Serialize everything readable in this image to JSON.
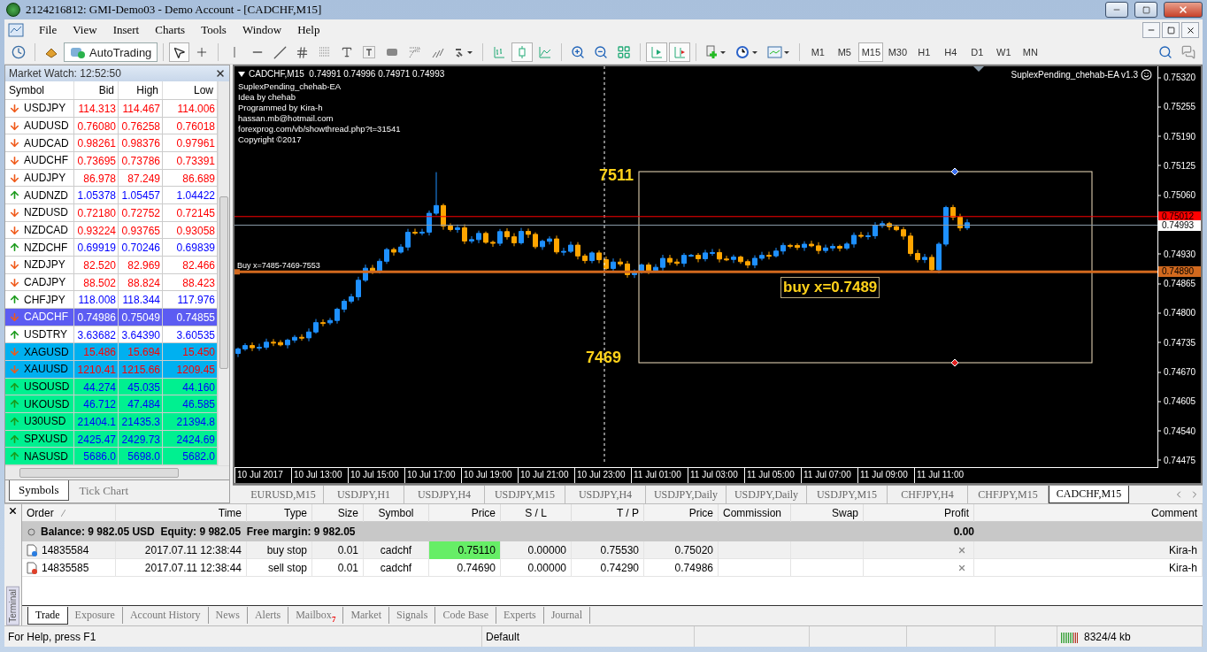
{
  "window": {
    "title": "2124216812: GMI-Demo03 - Demo Account - [CADCHF,M15]"
  },
  "menu": [
    "File",
    "View",
    "Insert",
    "Charts",
    "Tools",
    "Window",
    "Help"
  ],
  "toolbar": {
    "autotrading": {
      "label": "AutoTrading",
      "on": true
    },
    "timeframes": [
      {
        "label": "M1",
        "selected": false
      },
      {
        "label": "M5",
        "selected": false
      },
      {
        "label": "M15",
        "selected": true
      },
      {
        "label": "M30",
        "selected": false
      },
      {
        "label": "H1",
        "selected": false
      },
      {
        "label": "H4",
        "selected": false
      },
      {
        "label": "D1",
        "selected": false
      },
      {
        "label": "W1",
        "selected": false
      },
      {
        "label": "MN",
        "selected": false
      }
    ]
  },
  "market_watch": {
    "title": "Market Watch: 12:52:50",
    "columns": [
      "Symbol",
      "Bid",
      "High",
      "Low"
    ],
    "rows": [
      {
        "symbol": "USDJPY",
        "bid": "114.313",
        "high": "114.467",
        "low": "114.006",
        "kind": "down",
        "color": "#ffffff",
        "selected": false
      },
      {
        "symbol": "AUDUSD",
        "bid": "0.76080",
        "high": "0.76258",
        "low": "0.76018",
        "kind": "down",
        "color": "#ffffff",
        "selected": false
      },
      {
        "symbol": "AUDCAD",
        "bid": "0.98261",
        "high": "0.98376",
        "low": "0.97961",
        "kind": "down",
        "color": "#ffffff",
        "selected": false
      },
      {
        "symbol": "AUDCHF",
        "bid": "0.73695",
        "high": "0.73786",
        "low": "0.73391",
        "kind": "down",
        "color": "#ffffff",
        "selected": false
      },
      {
        "symbol": "AUDJPY",
        "bid": "86.978",
        "high": "87.249",
        "low": "86.689",
        "kind": "down",
        "color": "#ffffff",
        "selected": false
      },
      {
        "symbol": "AUDNZD",
        "bid": "1.05378",
        "high": "1.05457",
        "low": "1.04422",
        "kind": "up",
        "color": "#ffffff",
        "selected": false
      },
      {
        "symbol": "NZDUSD",
        "bid": "0.72180",
        "high": "0.72752",
        "low": "0.72145",
        "kind": "down",
        "color": "#ffffff",
        "selected": false
      },
      {
        "symbol": "NZDCAD",
        "bid": "0.93224",
        "high": "0.93765",
        "low": "0.93058",
        "kind": "down",
        "color": "#ffffff",
        "selected": false
      },
      {
        "symbol": "NZDCHF",
        "bid": "0.69919",
        "high": "0.70246",
        "low": "0.69839",
        "kind": "up",
        "color": "#ffffff",
        "selected": false
      },
      {
        "symbol": "NZDJPY",
        "bid": "82.520",
        "high": "82.969",
        "low": "82.466",
        "kind": "down",
        "color": "#ffffff",
        "selected": false
      },
      {
        "symbol": "CADJPY",
        "bid": "88.502",
        "high": "88.824",
        "low": "88.423",
        "kind": "down",
        "color": "#ffffff",
        "selected": false
      },
      {
        "symbol": "CHFJPY",
        "bid": "118.008",
        "high": "118.344",
        "low": "117.976",
        "kind": "up",
        "color": "#ffffff",
        "selected": false
      },
      {
        "symbol": "CADCHF",
        "bid": "0.74986",
        "high": "0.75049",
        "low": "0.74855",
        "kind": "down",
        "color": "#5c5cf2",
        "selected": true
      },
      {
        "symbol": "USDTRY",
        "bid": "3.63682",
        "high": "3.64390",
        "low": "3.60535",
        "kind": "up",
        "color": "#ffffff",
        "selected": false
      },
      {
        "symbol": "XAGUSD",
        "bid": "15.486",
        "high": "15.694",
        "low": "15.450",
        "kind": "down",
        "color": "#00b0f0",
        "selected": false
      },
      {
        "symbol": "XAUUSD",
        "bid": "1210.41",
        "high": "1215.66",
        "low": "1209.45",
        "kind": "down",
        "color": "#00b0f0",
        "selected": false
      },
      {
        "symbol": "USOUSD",
        "bid": "44.274",
        "high": "45.035",
        "low": "44.160",
        "kind": "up",
        "color": "#00f090",
        "selected": false
      },
      {
        "symbol": "UKOUSD",
        "bid": "46.712",
        "high": "47.484",
        "low": "46.585",
        "kind": "up",
        "color": "#00f090",
        "selected": false
      },
      {
        "symbol": "U30USD",
        "bid": "21404.1",
        "high": "21435.3",
        "low": "21394.8",
        "kind": "up",
        "color": "#00f090",
        "selected": false
      },
      {
        "symbol": "SPXUSD",
        "bid": "2425.47",
        "high": "2429.73",
        "low": "2424.69",
        "kind": "up",
        "color": "#00f090",
        "selected": false
      },
      {
        "symbol": "NASUSD",
        "bid": "5686.0",
        "high": "5698.0",
        "low": "5682.0",
        "kind": "up",
        "color": "#00f090",
        "selected": false
      }
    ],
    "tabs": [
      {
        "label": "Symbols",
        "selected": true
      },
      {
        "label": "Tick Chart",
        "selected": false
      }
    ]
  },
  "chart": {
    "header": "CADCHF,M15  0.74991 0.74996 0.74971 0.74993",
    "info": [
      "SuplexPending_chehab-EA",
      "Idea by chehab",
      "Programmed by Kira-h",
      "hassan.mb@hotmail.com",
      "forexprog.com/vb/showthread.php?t=31541",
      "Copyright ©2017"
    ],
    "ea_label": "SuplexPending_chehab-EA v1.3",
    "upper_level": "7511",
    "lower_level": "7469",
    "buy_label": "buy x=0.7489",
    "order_comment": "Buy x=7485-7469-7553",
    "price_ticks": [
      "0.75320",
      "0.75255",
      "0.75190",
      "0.75125",
      "0.75060",
      "0.74930",
      "0.74865",
      "0.74800",
      "0.74735",
      "0.74670",
      "0.74605",
      "0.74540",
      "0.74475"
    ],
    "price_markers": [
      {
        "kind": "ask",
        "label": "0.75012"
      },
      {
        "kind": "bid",
        "label": "0.74993"
      },
      {
        "kind": "order",
        "label": "0.74890"
      }
    ],
    "time_labels": [
      "10 Jul 2017",
      "10 Jul 13:00",
      "10 Jul 15:00",
      "10 Jul 17:00",
      "10 Jul 19:00",
      "10 Jul 21:00",
      "10 Jul 23:00",
      "11 Jul 01:00",
      "11 Jul 03:00",
      "11 Jul 05:00",
      "11 Jul 07:00",
      "11 Jul 09:00",
      "11 Jul 11:00"
    ]
  },
  "chart_tabs": [
    {
      "label": "EURUSD,M15",
      "selected": false
    },
    {
      "label": "USDJPY,H1",
      "selected": false
    },
    {
      "label": "USDJPY,H4",
      "selected": false
    },
    {
      "label": "USDJPY,M15",
      "selected": false
    },
    {
      "label": "USDJPY,H4",
      "selected": false
    },
    {
      "label": "USDJPY,Daily",
      "selected": false
    },
    {
      "label": "USDJPY,Daily",
      "selected": false
    },
    {
      "label": "USDJPY,M15",
      "selected": false
    },
    {
      "label": "CHFJPY,H4",
      "selected": false
    },
    {
      "label": "CHFJPY,M15",
      "selected": false
    },
    {
      "label": "CADCHF,M15",
      "selected": true
    }
  ],
  "terminal": {
    "title": "Terminal",
    "columns": [
      "Order",
      "Time",
      "Type",
      "Size",
      "Symbol",
      "Price",
      "S / L",
      "T / P",
      "Price",
      "Commission",
      "Swap",
      "Profit",
      "Comment"
    ],
    "balance": "Balance: 9 982.05 USD  Equity: 9 982.05  Free margin: 9 982.05",
    "balance_profit": "0.00",
    "orders": [
      {
        "kind": "buy",
        "order": "14835584",
        "time": "2017.07.11 12:38:44",
        "type": "buy stop",
        "size": "0.01",
        "symbol": "cadchf",
        "price": "0.75110",
        "highlighted": true,
        "sl": "0.00000",
        "tp": "0.75530",
        "current": "0.75020",
        "comment": "Kira-h"
      },
      {
        "kind": "sell",
        "order": "14835585",
        "time": "2017.07.11 12:38:44",
        "type": "sell stop",
        "size": "0.01",
        "symbol": "cadchf",
        "price": "0.74690",
        "highlighted": false,
        "sl": "0.00000",
        "tp": "0.74290",
        "current": "0.74986",
        "comment": "Kira-h"
      }
    ],
    "tabs": [
      {
        "label": "Trade",
        "selected": true
      },
      {
        "label": "Exposure",
        "selected": false
      },
      {
        "label": "Account History",
        "selected": false
      },
      {
        "label": "News",
        "selected": false
      },
      {
        "label": "Alerts",
        "selected": false
      },
      {
        "label": "Mailbox",
        "selected": false,
        "badge": "7"
      },
      {
        "label": "Market",
        "selected": false
      },
      {
        "label": "Signals",
        "selected": false
      },
      {
        "label": "Code Base",
        "selected": false
      },
      {
        "label": "Experts",
        "selected": false
      },
      {
        "label": "Journal",
        "selected": false
      }
    ]
  },
  "status_bar": {
    "help": "For Help, press F1",
    "profile": "Default",
    "traffic": "8324/4 kb"
  }
}
